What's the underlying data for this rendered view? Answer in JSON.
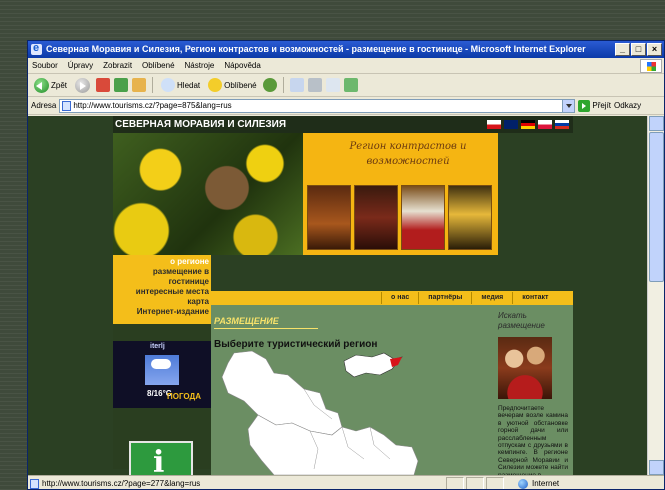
{
  "window": {
    "title": "Северная Моравия и Силезия, Регион контрастов и возможностей - размещение в гостинице - Microsoft Internet Explorer",
    "buttons": [
      "_",
      "□",
      "×"
    ]
  },
  "menu": [
    "Soubor",
    "Úpravy",
    "Zobrazit",
    "Oblíbené",
    "Nástroje",
    "Nápověda"
  ],
  "toolbar": {
    "back_label": "Zpět",
    "search_label": "Hledat",
    "favorites_label": "Oblíbené"
  },
  "address": {
    "label": "Adresa",
    "url": "http://www.tourisms.cz/?page=875&lang=rus",
    "go_label": "Přejít",
    "links_label": "Odkazy"
  },
  "status": {
    "text": "http://www.tourisms.cz/?page=277&lang=rus",
    "zone": "Internet"
  },
  "site": {
    "header": "СЕВЕРНАЯ МОРАВИЯ И СИЛЕЗИЯ",
    "flags": [
      "#d7141a",
      "#012169",
      "#000000",
      "#c8102e",
      "#0039a6"
    ],
    "banner_title": "Регион контрастов и возможностей",
    "nav": [
      "о регионе",
      "размещение в гостинице",
      "интересные места",
      "карта",
      "Интернет-издание"
    ],
    "weather": {
      "label": "iterlj",
      "temp": "8/16°C",
      "title": "ПОГОДА"
    },
    "top_tabs": [
      "о нас",
      "партнёры",
      "медия",
      "контакт"
    ],
    "section_title": "РАЗМЕЩЕНИЕ",
    "choose_region": "Выберите туристический регион",
    "search_title": "Искать размещение",
    "promo_text": "Предпочитаете вечерам возле камина в уютной обстановке горной дачи или расслабленным отпускам с друзьями в кемпинге. В регионе Северной Моравии и Силезии можете найти размещение в"
  }
}
